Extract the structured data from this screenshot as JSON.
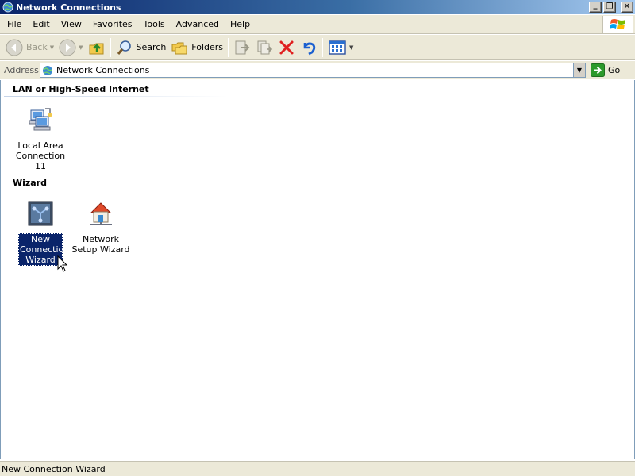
{
  "window": {
    "title": "Network Connections",
    "controls": {
      "minimize": "_",
      "restore": "❐",
      "close": "✕"
    }
  },
  "menubar": {
    "items": [
      "File",
      "Edit",
      "View",
      "Favorites",
      "Tools",
      "Advanced",
      "Help"
    ]
  },
  "toolbar": {
    "back_label": "Back",
    "search_label": "Search",
    "folders_label": "Folders"
  },
  "addressbar": {
    "label": "Address",
    "value": "Network Connections",
    "go_label": "Go"
  },
  "groups": [
    {
      "header": "LAN or High-Speed Internet",
      "items": [
        {
          "label": "Local Area Connection 11",
          "icon": "lan-connection-icon",
          "selected": false
        }
      ]
    },
    {
      "header": "Wizard",
      "items": [
        {
          "label": "New Connection Wizard",
          "icon": "new-connection-wizard-icon",
          "selected": true
        },
        {
          "label": "Network Setup Wizard",
          "icon": "network-setup-wizard-icon",
          "selected": false
        }
      ]
    }
  ],
  "statusbar": {
    "text": "New Connection Wizard"
  },
  "colors": {
    "titlebar_start": "#0a246a",
    "selection": "#0a246a",
    "chrome": "#ece9d8",
    "close_x": "#e02020",
    "go_green": "#2c9a2c"
  }
}
